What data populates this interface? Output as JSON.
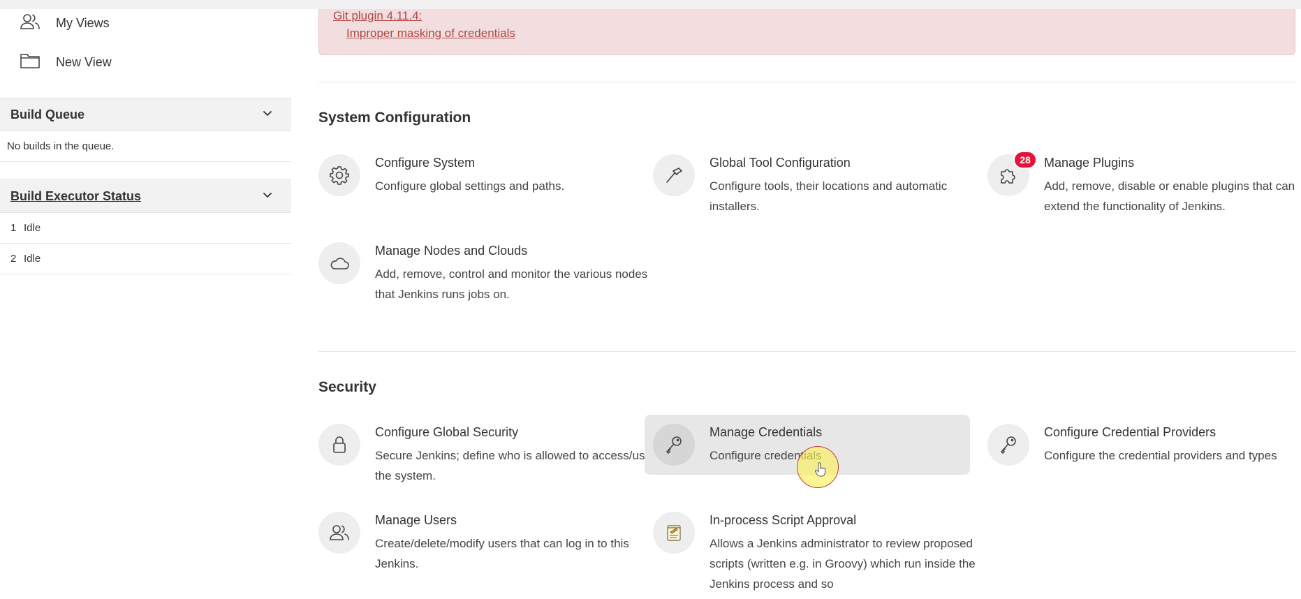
{
  "sidebar": {
    "nav": [
      {
        "label": "My Views",
        "icon": "people-icon"
      },
      {
        "label": "New View",
        "icon": "folder-icon"
      }
    ],
    "build_queue": {
      "title": "Build Queue",
      "empty_text": "No builds in the queue."
    },
    "executor_status": {
      "title": "Build Executor Status",
      "executors": [
        {
          "number": "1",
          "status": "Idle"
        },
        {
          "number": "2",
          "status": "Idle"
        }
      ]
    }
  },
  "alert": {
    "plugin_link": "Git plugin 4.11.4",
    "colon": ":",
    "issue_link": "Improper masking of credentials",
    "color": "#f2dede"
  },
  "sections": {
    "system": {
      "title": "System Configuration",
      "items": [
        {
          "title": "Configure System",
          "desc": "Configure global settings and paths.",
          "icon": "gear-icon"
        },
        {
          "title": "Global Tool Configuration",
          "desc": "Configure tools, their locations and automatic installers.",
          "icon": "hammer-icon"
        },
        {
          "title": "Manage Plugins",
          "desc": "Add, remove, disable or enable plugins that can extend the functionality of Jenkins.",
          "icon": "puzzle-icon",
          "badge": "28"
        },
        {
          "title": "Manage Nodes and Clouds",
          "desc": "Add, remove, control and monitor the various nodes that Jenkins runs jobs on.",
          "icon": "cloud-icon"
        }
      ]
    },
    "security": {
      "title": "Security",
      "items": [
        {
          "title": "Configure Global Security",
          "desc": "Secure Jenkins; define who is allowed to access/use the system.",
          "icon": "lock-icon"
        },
        {
          "title": "Manage Credentials",
          "desc": "Configure credentials",
          "icon": "key-icon"
        },
        {
          "title": "Configure Credential Providers",
          "desc": "Configure the credential providers and types",
          "icon": "key-icon"
        },
        {
          "title": "Manage Users",
          "desc": "Create/delete/modify users that can log in to this Jenkins.",
          "icon": "users-icon"
        },
        {
          "title": "In-process Script Approval",
          "desc": "Allows a Jenkins administrator to review proposed scripts (written e.g. in Groovy) which run inside the Jenkins process and so",
          "icon": "notepad-icon"
        }
      ]
    }
  },
  "colors": {
    "badge": "#e5133a",
    "alert_link": "#b14646",
    "hover": "#e7e7e7"
  }
}
